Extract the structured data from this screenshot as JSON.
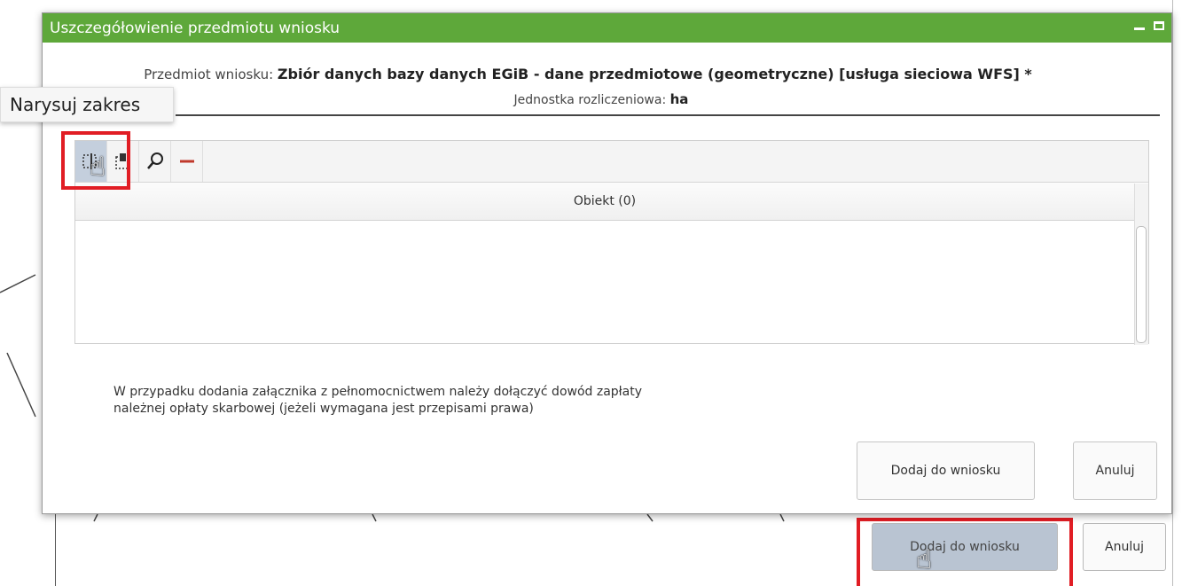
{
  "dialog": {
    "title": "Uszczegółowienie przedmiotu wniosku",
    "subject_label": "Przedmiot wniosku:",
    "subject_value": "Zbiór danych bazy danych EGiB - dane przedmiotowe (geometryczne) [usługa sieciowa WFS] *",
    "unit_label": "Jednostka rozliczeniowa:",
    "unit_value": "ha",
    "tooltip": "Narysuj zakres",
    "toolbar": [
      {
        "name": "draw-range-icon",
        "glyph": "⬚"
      },
      {
        "name": "select-object-icon",
        "glyph": "⎘"
      },
      {
        "name": "search-icon",
        "glyph": "⌕"
      },
      {
        "name": "remove-icon",
        "glyph": "—"
      }
    ],
    "column_header": "Obiekt (0)",
    "note_line1": "W przypadku dodania załącznika z pełnomocnictwem należy dołączyć dowód zapłaty",
    "note_line2": "należnej opłaty skarbowej (jeżeli wymagana jest przepisami prawa)",
    "add_button": "Dodaj do wniosku",
    "cancel_button": "Anuluj"
  },
  "background_form": {
    "add_button": "Dodaj do wniosku",
    "cancel_button": "Anuluj"
  },
  "colors": {
    "titlebar": "#5ea83a",
    "highlight_frame": "#e11d24"
  }
}
